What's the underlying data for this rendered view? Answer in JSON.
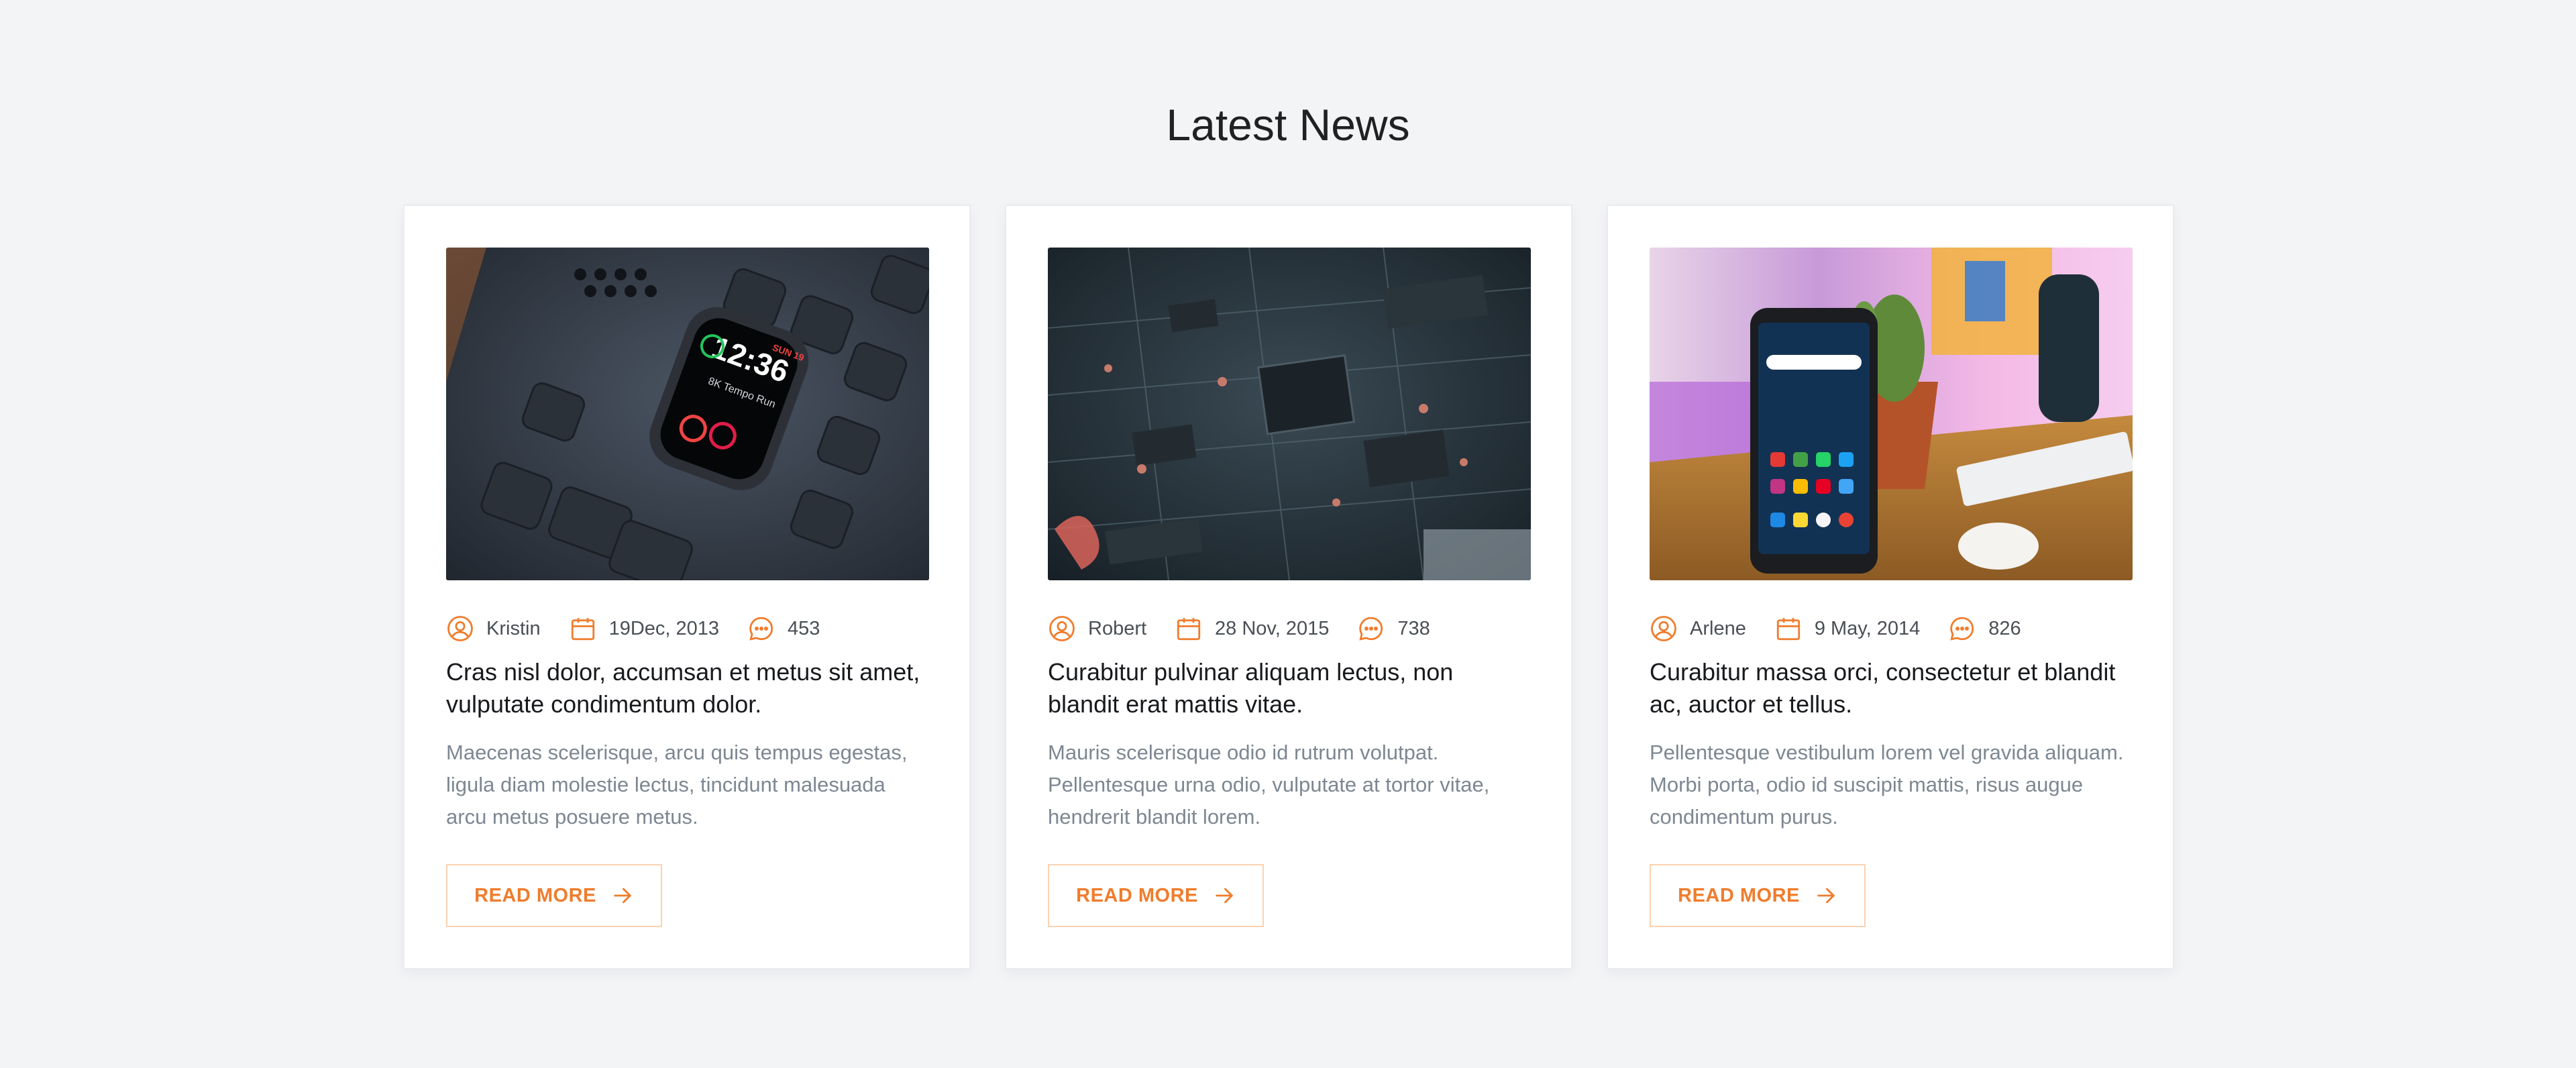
{
  "section": {
    "title": "Latest News"
  },
  "colors": {
    "accent": "#f07c2c",
    "background": "#f3f4f6",
    "card": "#ffffff"
  },
  "cards": [
    {
      "author": "Kristin",
      "date": "19Dec, 2013",
      "comments": "453",
      "title": "Cras nisl dolor, accumsan et metus sit amet, vulputate condimentum dolor.",
      "excerpt": "Maecenas scelerisque, arcu quis tempus egestas, ligula diam molestie lectus, tincidunt malesuada arcu metus posuere metus.",
      "read_more": "READ MORE",
      "image": "smartwatch-on-keyboard-photo"
    },
    {
      "author": "Robert",
      "date": "28 Nov, 2015",
      "comments": "738",
      "title": "Curabitur pulvinar aliquam lectus, non blandit erat mattis vitae.",
      "excerpt": "Mauris scelerisque odio id rutrum volutpat. Pellentesque urna odio, vulputate at tortor vitae, hendrerit blandit lorem.",
      "read_more": "READ MORE",
      "image": "circuit-board-photo"
    },
    {
      "author": "Arlene",
      "date": "9 May, 2014",
      "comments": "826",
      "title": "Curabitur massa orci, consectetur et blandit ac, auctor et tellus.",
      "excerpt": "Pellentesque vestibulum lorem vel gravida aliquam. Morbi porta, odio id suscipit mattis, risus augue condimentum purus.",
      "read_more": "READ MORE",
      "image": "smartphone-on-desk-photo"
    }
  ]
}
